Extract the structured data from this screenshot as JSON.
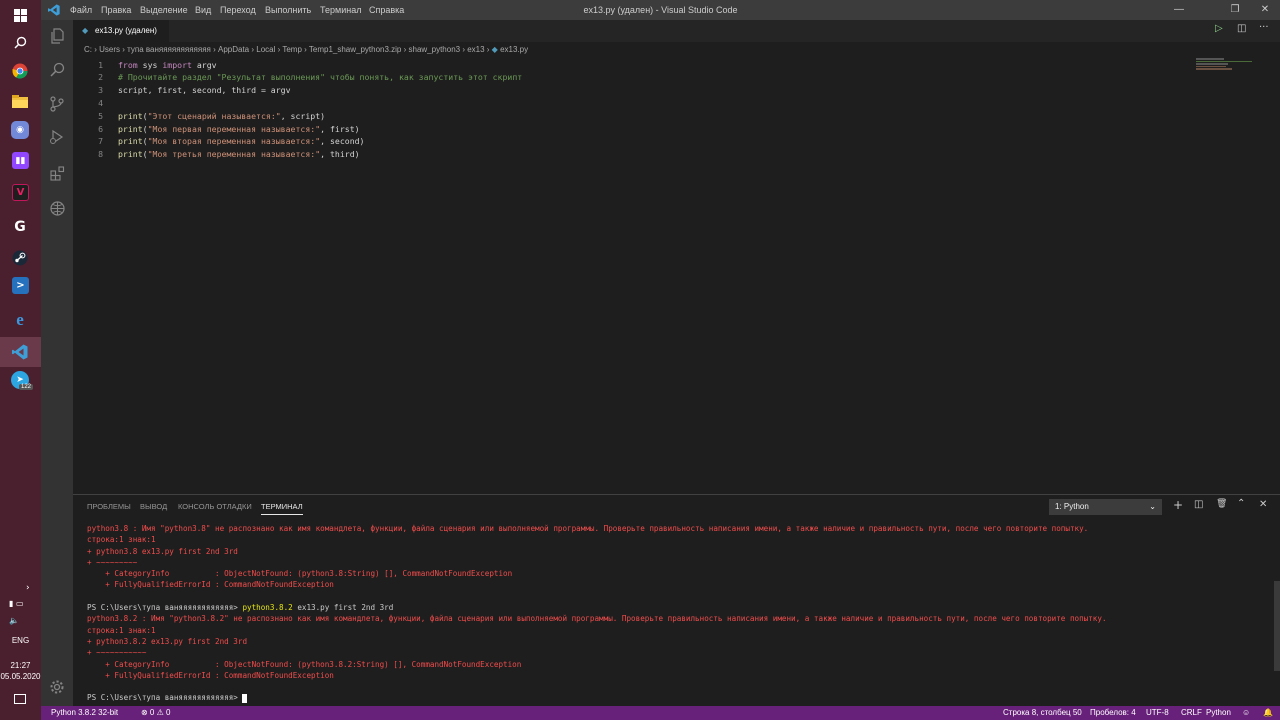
{
  "window": {
    "title": "ex13.py (удален) - Visual Studio Code",
    "menu": [
      "Файл",
      "Правка",
      "Выделение",
      "Вид",
      "Переход",
      "Выполнить",
      "Терминал",
      "Справка"
    ]
  },
  "taskbar": {
    "time": "21:27",
    "date": "05.05.2020",
    "lang": "ENG",
    "telegram_badge": "122",
    "icons": [
      "windows-start-icon",
      "search-icon",
      "chrome-icon",
      "file-explorer-icon",
      "discord-icon",
      "twitch-icon",
      "vs-icon",
      "logitech-icon",
      "steam-icon",
      "powershell-icon",
      "edge-icon",
      "vscode-icon",
      "telegram-icon"
    ]
  },
  "tab": {
    "label": "ex13.py (удален)"
  },
  "breadcrumb": {
    "items": [
      "C:",
      "Users",
      "тупа ваняяяяяяяяяяяя",
      "AppData",
      "Local",
      "Temp",
      "Temp1_shaw_python3.zip",
      "shaw_python3",
      "ex13",
      "ex13.py"
    ]
  },
  "editor": {
    "lines": [
      {
        "n": "1",
        "parts": [
          [
            "kw",
            "from"
          ],
          [
            "",
            " sys "
          ],
          [
            "kw",
            "import"
          ],
          [
            "",
            " argv"
          ]
        ]
      },
      {
        "n": "2",
        "parts": [
          [
            "cm",
            "# Прочитайте раздел \"Результат выполнения\" чтобы понять, как запустить этот скрипт"
          ]
        ]
      },
      {
        "n": "3",
        "parts": [
          [
            "",
            "script, first, second, third = argv"
          ]
        ]
      },
      {
        "n": "4",
        "parts": []
      },
      {
        "n": "5",
        "parts": [
          [
            "fn",
            "print"
          ],
          [
            "",
            "("
          ],
          [
            "str",
            "\"Этот сценарий называется:\""
          ],
          [
            "",
            ", script)"
          ]
        ]
      },
      {
        "n": "6",
        "parts": [
          [
            "fn",
            "print"
          ],
          [
            "",
            "("
          ],
          [
            "str",
            "\"Моя первая переменная называется:\""
          ],
          [
            "",
            ", first)"
          ]
        ]
      },
      {
        "n": "7",
        "parts": [
          [
            "fn",
            "print"
          ],
          [
            "",
            "("
          ],
          [
            "str",
            "\"Моя вторая переменная называется:\""
          ],
          [
            "",
            ", second)"
          ]
        ]
      },
      {
        "n": "8",
        "parts": [
          [
            "fn",
            "print"
          ],
          [
            "",
            "("
          ],
          [
            "str",
            "\"Моя третья переменная называется:\""
          ],
          [
            "",
            ", third)"
          ]
        ]
      }
    ]
  },
  "panel": {
    "tabs": [
      "ПРОБЛЕМЫ",
      "ВЫВОД",
      "КОНСОЛЬ ОТЛАДКИ",
      "ТЕРМИНАЛ"
    ],
    "active_tab": "ТЕРМИНАЛ",
    "terminal_select": "1: Python",
    "terminal": [
      {
        "cls": "err",
        "text": "python3.8 : Имя \"python3.8\" не распознано как имя командлета, функции, файла сценария или выполняемой программы. Проверьте правильность написания имени, а также наличие и правильность пути, после чего повторите попытку."
      },
      {
        "cls": "err",
        "text": "строка:1 знак:1"
      },
      {
        "cls": "err",
        "text": "+ python3.8 ex13.py first 2nd 3rd"
      },
      {
        "cls": "err",
        "text": "+ ~~~~~~~~~"
      },
      {
        "cls": "err",
        "text": "    + CategoryInfo          : ObjectNotFound: (python3.8:String) [], CommandNotFoundException"
      },
      {
        "cls": "err",
        "text": "    + FullyQualifiedErrorId : CommandNotFoundException"
      },
      {
        "cls": "",
        "text": " "
      },
      {
        "cls": "prompt-line",
        "prompt": "PS C:\\Users\\тупа ваняяяяяяяяяяяя> ",
        "cmd": "python3.8.2",
        "rest": " ex13.py first 2nd 3rd"
      },
      {
        "cls": "err",
        "text": "python3.8.2 : Имя \"python3.8.2\" не распознано как имя командлета, функции, файла сценария или выполняемой программы. Проверьте правильность написания имени, а также наличие и правильность пути, после чего повторите попытку."
      },
      {
        "cls": "err",
        "text": "строка:1 знак:1"
      },
      {
        "cls": "err",
        "text": "+ python3.8.2 ex13.py first 2nd 3rd"
      },
      {
        "cls": "err",
        "text": "+ ~~~~~~~~~~~"
      },
      {
        "cls": "err",
        "text": "    + CategoryInfo          : ObjectNotFound: (python3.8.2:String) [], CommandNotFoundException"
      },
      {
        "cls": "err",
        "text": "    + FullyQualifiedErrorId : CommandNotFoundException"
      },
      {
        "cls": "",
        "text": " "
      },
      {
        "cls": "final",
        "prompt": "PS C:\\Users\\тупа ваняяяяяяяяяяяя> "
      }
    ]
  },
  "statusbar": {
    "interpreter": "Python 3.8.2 32-bit",
    "problems": "⊗ 0 ⚠ 0",
    "position": "Строка 8, столбец 50",
    "spaces": "Пробелов: 4",
    "encoding": "UTF-8",
    "eol": "CRLF",
    "language": "Python"
  },
  "colors": {
    "accent_statusbar": "#68217a",
    "taskbar": "#4a1f2e",
    "error": "#f14c4c"
  }
}
